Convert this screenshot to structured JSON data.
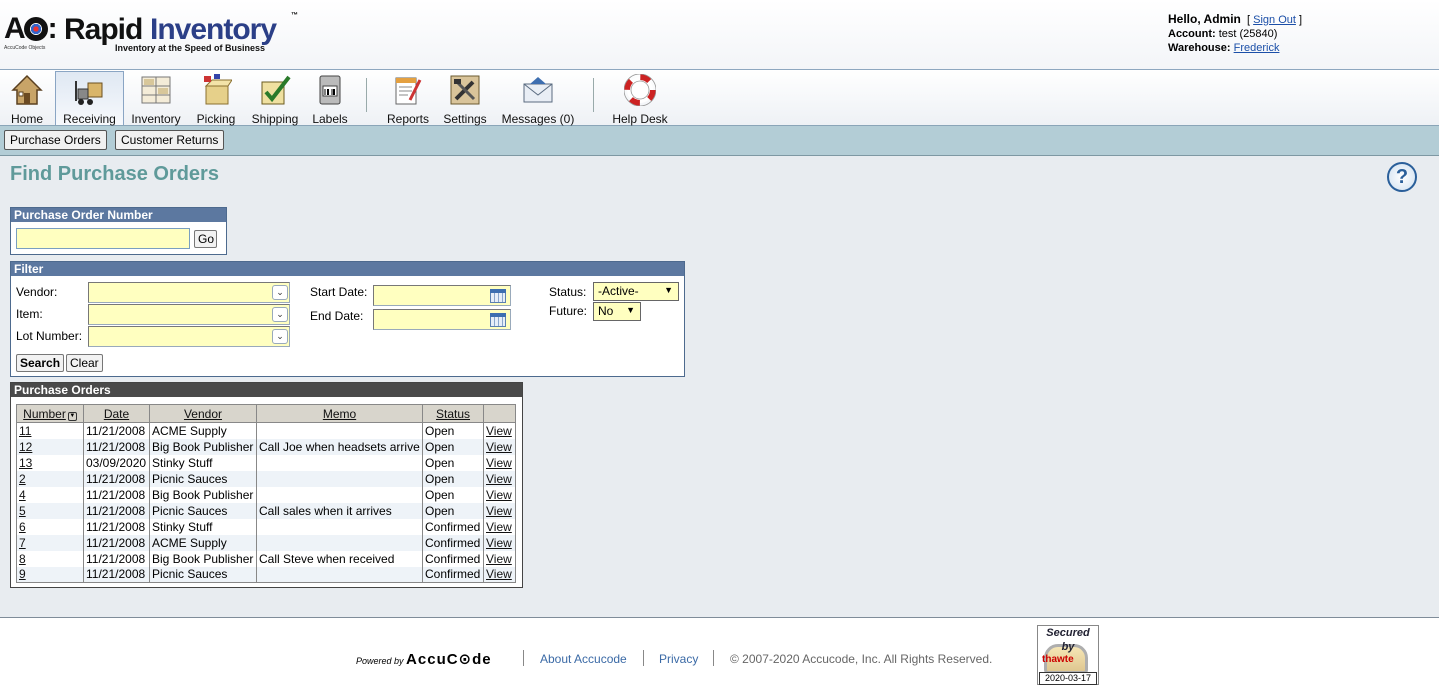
{
  "brand": {
    "logo_prefix": "AO:",
    "logo_rapid": "Rapid",
    "logo_inventory": "Inventory",
    "logo_tm": "™",
    "tagline": "Inventory at the Speed of Business",
    "accucode_objects": "AccuCode Objects"
  },
  "user": {
    "hello": "Hello, Admin",
    "sign_out": "Sign Out",
    "account_label": "Account:",
    "account_value": "test (25840)",
    "warehouse_label": "Warehouse:",
    "warehouse_value": "Frederick"
  },
  "toolbar": {
    "items": [
      {
        "label": "Home",
        "icon": "house-icon"
      },
      {
        "label": "Receiving",
        "icon": "forklift-icon",
        "active": true
      },
      {
        "label": "Inventory",
        "icon": "shelves-icon"
      },
      {
        "label": "Picking",
        "icon": "box-icon"
      },
      {
        "label": "Shipping",
        "icon": "checkbox-icon"
      },
      {
        "label": "Labels",
        "icon": "printer-icon"
      },
      {
        "label": "Reports",
        "icon": "report-icon"
      },
      {
        "label": "Settings",
        "icon": "tools-icon"
      },
      {
        "label": "Messages (0)",
        "icon": "envelope-icon"
      },
      {
        "label": "Help Desk",
        "icon": "lifebuoy-icon"
      }
    ]
  },
  "subnav": {
    "purchase_orders": "Purchase Orders",
    "customer_returns": "Customer Returns"
  },
  "page": {
    "title": "Find Purchase Orders",
    "help_glyph": "?"
  },
  "po_number": {
    "header": "Purchase Order Number",
    "value": "",
    "go": "Go"
  },
  "filter": {
    "header": "Filter",
    "vendor_label": "Vendor:",
    "item_label": "Item:",
    "lot_label": "Lot Number:",
    "start_label": "Start Date:",
    "end_label": "End Date:",
    "status_label": "Status:",
    "status_value": "-Active-",
    "future_label": "Future:",
    "future_value": "No",
    "search": "Search",
    "clear": "Clear"
  },
  "orders": {
    "header": "Purchase Orders",
    "columns": [
      "Number",
      "Date",
      "Vendor",
      "Memo",
      "Status",
      ""
    ],
    "view_label": "View",
    "rows": [
      {
        "number": "11",
        "date": "11/21/2008",
        "vendor": "ACME Supply",
        "memo": "",
        "status": "Open"
      },
      {
        "number": "12",
        "date": "11/21/2008",
        "vendor": "Big Book Publisher",
        "memo": "Call Joe when headsets arrive",
        "status": "Open"
      },
      {
        "number": "13",
        "date": "03/09/2020",
        "vendor": "Stinky Stuff",
        "memo": "",
        "status": "Open"
      },
      {
        "number": "2",
        "date": "11/21/2008",
        "vendor": "Picnic Sauces",
        "memo": "",
        "status": "Open"
      },
      {
        "number": "4",
        "date": "11/21/2008",
        "vendor": "Big Book Publisher",
        "memo": "",
        "status": "Open"
      },
      {
        "number": "5",
        "date": "11/21/2008",
        "vendor": "Picnic Sauces",
        "memo": "Call sales when it arrives",
        "status": "Open"
      },
      {
        "number": "6",
        "date": "11/21/2008",
        "vendor": "Stinky Stuff",
        "memo": "",
        "status": "Confirmed"
      },
      {
        "number": "7",
        "date": "11/21/2008",
        "vendor": "ACME Supply",
        "memo": "",
        "status": "Confirmed"
      },
      {
        "number": "8",
        "date": "11/21/2008",
        "vendor": "Big Book Publisher",
        "memo": "Call Steve when received",
        "status": "Confirmed"
      },
      {
        "number": "9",
        "date": "11/21/2008",
        "vendor": "Picnic Sauces",
        "memo": "",
        "status": "Confirmed"
      }
    ]
  },
  "footer": {
    "powered_by": "Powered by",
    "accucode": "AccuC⊙de",
    "about": "About Accucode",
    "privacy": "Privacy",
    "copyright": "© 2007-2020 Accucode, Inc. All Rights Reserved.",
    "seal_line1": "Secured",
    "seal_line2": "by",
    "seal_brand": "thawte",
    "seal_date": "2020-03-17"
  }
}
